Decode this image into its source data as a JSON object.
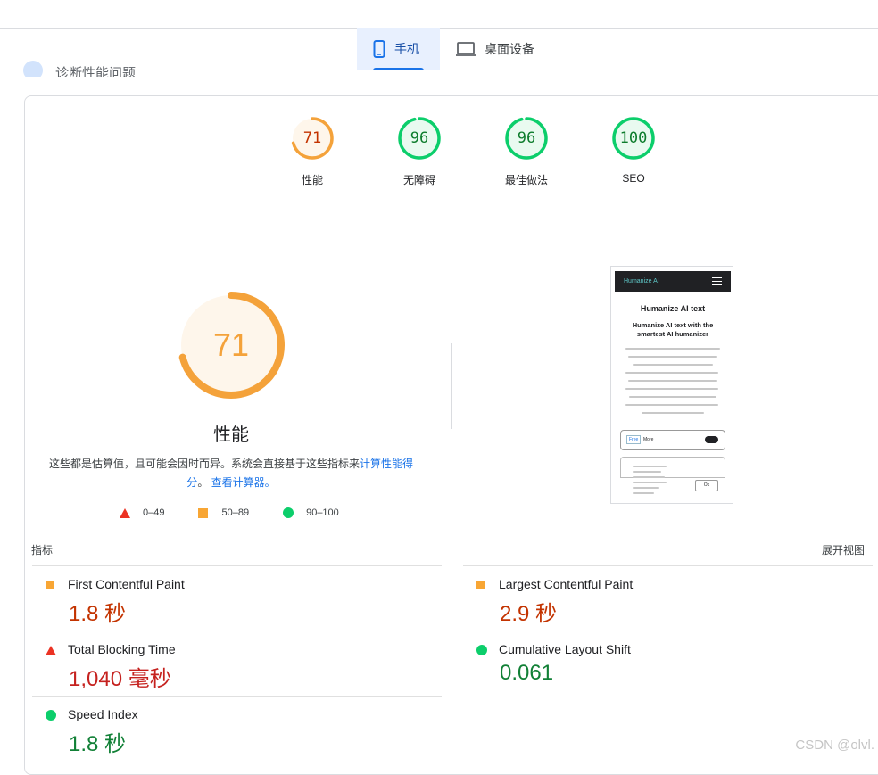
{
  "tabs": [
    {
      "label": "手机",
      "icon": "phone-icon",
      "active": true
    },
    {
      "label": "桌面设备",
      "icon": "laptop-icon",
      "active": false
    }
  ],
  "hidden_heading": "诊断性能问题",
  "gauges": [
    {
      "score": "71",
      "label": "性能",
      "color": "#f4a23a",
      "fill": 0.71,
      "bg": "#fef6eb"
    },
    {
      "score": "96",
      "label": "无障碍",
      "color": "#0cce6b",
      "fill": 0.96,
      "bg": "#e9faf0"
    },
    {
      "score": "96",
      "label": "最佳做法",
      "color": "#0cce6b",
      "fill": 0.96,
      "bg": "#e9faf0"
    },
    {
      "score": "100",
      "label": "SEO",
      "color": "#0cce6b",
      "fill": 1.0,
      "bg": "#e9faf0"
    }
  ],
  "performance": {
    "score": "71",
    "fill": 0.71,
    "label": "性能",
    "desc_1": "这些都是估算值，且可能会因时而异。系统会直接基于这些指标来",
    "desc_link_1": "计算性能得分",
    "desc_2": "。",
    "desc_link_2": "查看计算器。"
  },
  "legend": [
    {
      "shape": "triangle",
      "range": "0–49"
    },
    {
      "shape": "square",
      "range": "50–89"
    },
    {
      "shape": "circle",
      "range": "90–100"
    }
  ],
  "screenshot": {
    "brand": "Humanize AI",
    "title": "Humanize AI text",
    "subtitle_1": "Humanize AI text with the",
    "subtitle_2": "smartest AI humanizer",
    "free": "Free",
    "more": "More",
    "ok": "Ok"
  },
  "metrics_header": "指标",
  "expand_label": "展开视图",
  "metrics": [
    {
      "name": "First Contentful Paint",
      "value": "1.8 秒",
      "rating": "average"
    },
    {
      "name": "Largest Contentful Paint",
      "value": "2.9 秒",
      "rating": "average"
    },
    {
      "name": "Total Blocking Time",
      "value": "1,040 毫秒",
      "rating": "fail"
    },
    {
      "name": "Cumulative Layout Shift",
      "value": "0.061",
      "rating": "pass"
    },
    {
      "name": "Speed Index",
      "value": "1.8 秒",
      "rating": "pass"
    }
  ],
  "watermark": "CSDN @olvl."
}
